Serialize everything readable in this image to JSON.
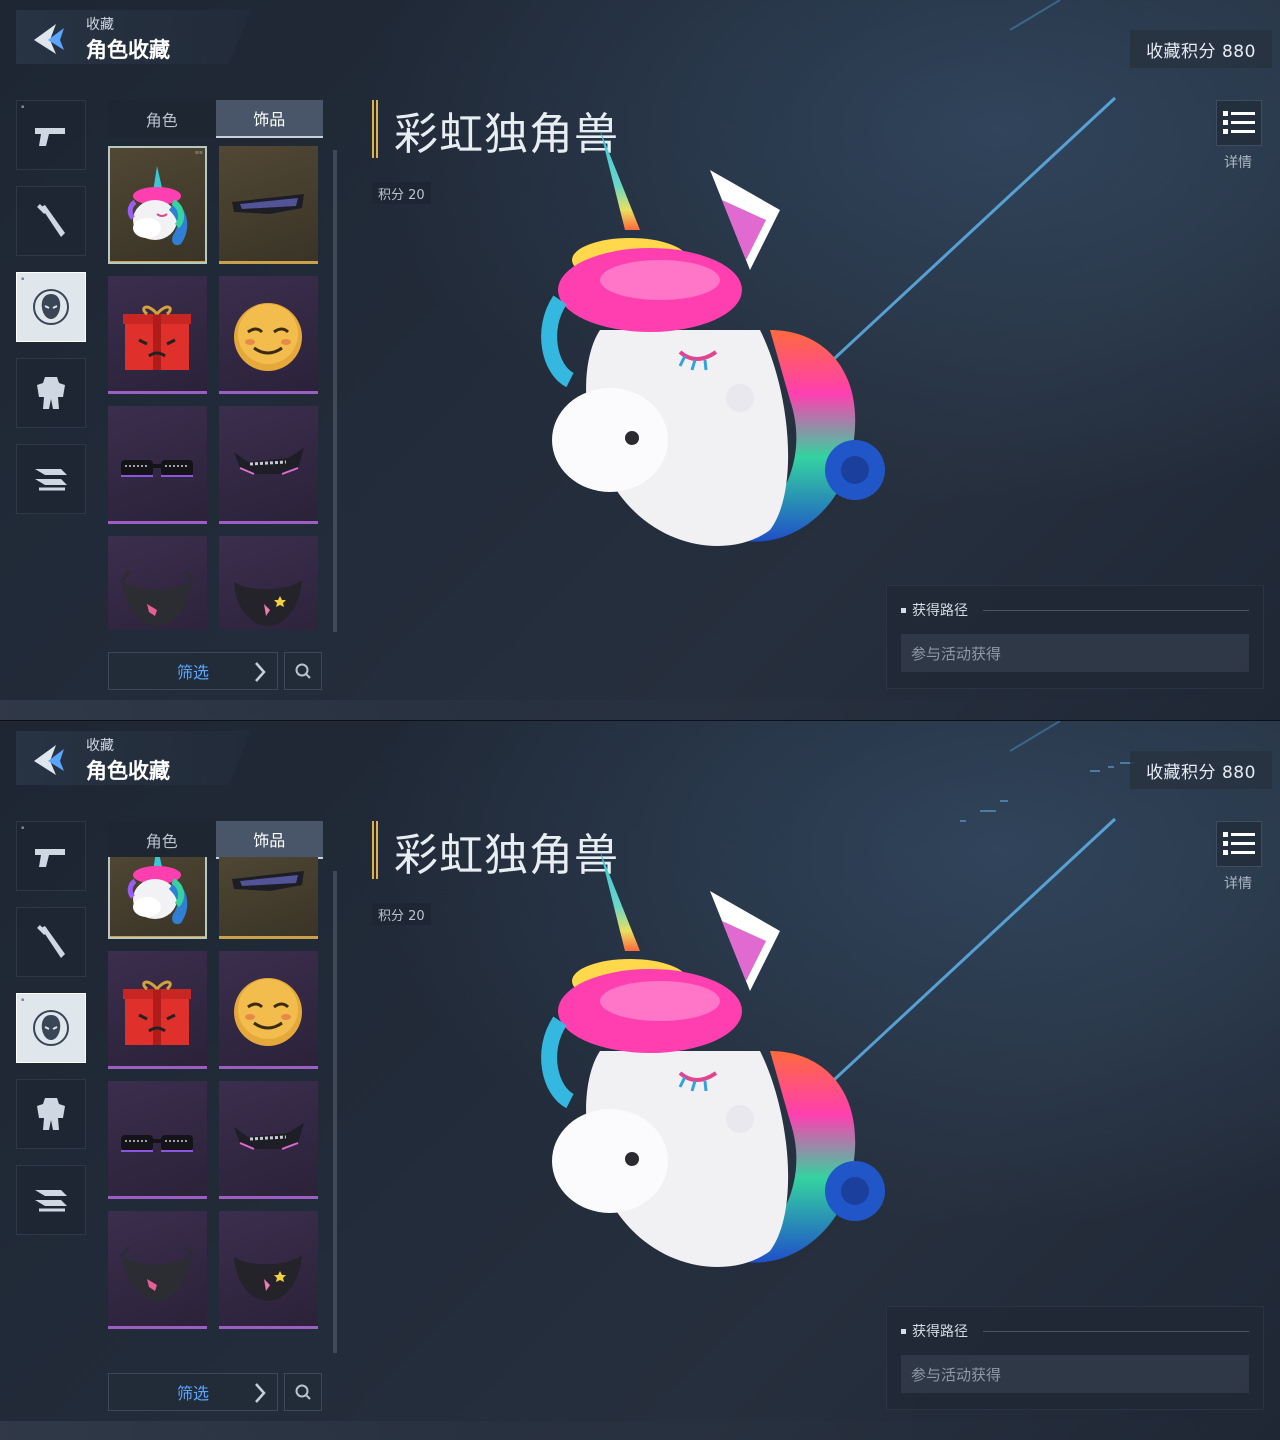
{
  "header": {
    "breadcrumb_parent": "收藏",
    "page_title": "角色收藏"
  },
  "collection_score": "收藏积分 880",
  "tabs": [
    {
      "label": "角色",
      "active": false
    },
    {
      "label": "饰品",
      "active": true
    }
  ],
  "sidebar": {
    "items": [
      {
        "icon": "pistol-icon",
        "active": false
      },
      {
        "icon": "melee-weapon-icon",
        "active": false
      },
      {
        "icon": "character-head-icon",
        "active": true
      },
      {
        "icon": "mech-armor-icon",
        "active": false
      },
      {
        "icon": "vehicle-icon",
        "active": false
      }
    ]
  },
  "items": [
    {
      "icon": "unicorn-head-icon",
      "rarity": "gold",
      "selected": true
    },
    {
      "icon": "visor-glasses-icon",
      "rarity": "gold",
      "selected": false
    },
    {
      "icon": "gift-box-icon",
      "rarity": "purple",
      "selected": false
    },
    {
      "icon": "smiley-ball-icon",
      "rarity": "purple",
      "selected": false
    },
    {
      "icon": "sunglasses-icon",
      "rarity": "purple",
      "selected": false
    },
    {
      "icon": "spiked-visor-icon",
      "rarity": "purple",
      "selected": false
    },
    {
      "icon": "mask-icon",
      "rarity": "purple",
      "selected": false
    },
    {
      "icon": "mask-icon",
      "rarity": "purple",
      "selected": false
    }
  ],
  "grid_scroll_fraction": [
    0,
    0.35
  ],
  "filter_label": "筛选",
  "selected_item": {
    "name": "彩虹独角兽",
    "score": "积分 20"
  },
  "details_label": "详情",
  "acquire": {
    "title": "获得路径",
    "method": "参与活动获得"
  },
  "colors": {
    "accent_gold": "#e1b04a",
    "filter_blue": "#5aa6ff",
    "rarity_purple": "#9a5fc0",
    "rarity_gold": "#c8a14a"
  }
}
